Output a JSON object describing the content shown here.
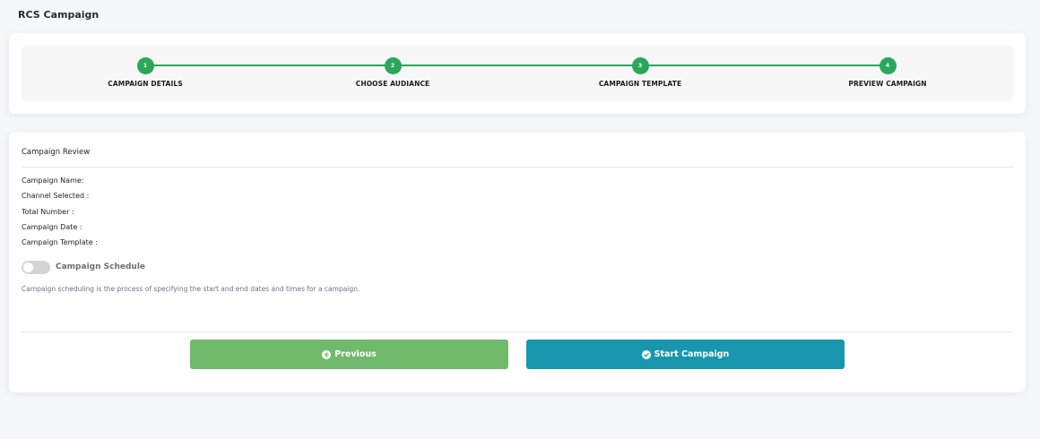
{
  "page": {
    "title": "RCS Campaign"
  },
  "stepper": {
    "accent_color": "#2aa85a",
    "steps": [
      {
        "number": "1",
        "label": "CAMPAIGN DETAILS"
      },
      {
        "number": "2",
        "label": "CHOOSE AUDIANCE"
      },
      {
        "number": "3",
        "label": "CAMPAIGN TEMPLATE"
      },
      {
        "number": "4",
        "label": "PREVIEW CAMPAIGN"
      }
    ]
  },
  "review": {
    "title": "Campaign Review",
    "fields": [
      {
        "label": "Campaign Name:"
      },
      {
        "label": "Channel Selected :"
      },
      {
        "label": "Total Number :"
      },
      {
        "label": "Campaign Date :"
      },
      {
        "label": "Campaign Template :"
      }
    ],
    "schedule": {
      "label": "Campaign Schedule",
      "enabled": false,
      "description": "Campaign scheduling is the process of specifying the start and end dates and times for a campaign."
    }
  },
  "actions": {
    "previous": {
      "label": "Previous",
      "icon": "arrow-circle-left-icon",
      "color": "#6fbb6b"
    },
    "start": {
      "label": "Start Campaign",
      "icon": "check-circle-icon",
      "color": "#1896ae"
    }
  }
}
